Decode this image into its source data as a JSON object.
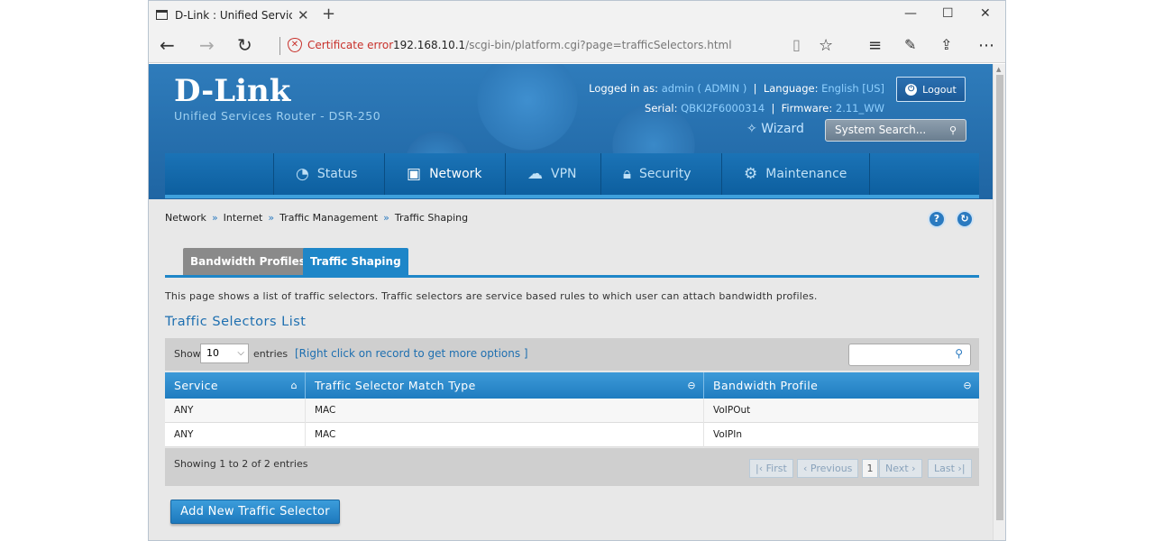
{
  "browser": {
    "tab_title": "D-Link : Unified Service:",
    "tab_close": "✕",
    "new_tab": "+",
    "win_min": "—",
    "win_max": "☐",
    "win_close": "✕",
    "cert_error": "Certificate error",
    "url_host": "192.168.10.1",
    "url_path": "/scgi-bin/platform.cgi?page=trafficSelectors.html"
  },
  "header": {
    "logo": "D-Link",
    "subtitle": "Unified Services Router - DSR-250",
    "logged_in_label": "Logged in as:",
    "user": "admin ( ADMIN )",
    "language_label": "Language:",
    "language": "English [US]",
    "serial_label": "Serial:",
    "serial": "QBKI2F6000314",
    "firmware_label": "Firmware:",
    "firmware": "2.11_WW",
    "logout": "Logout",
    "wizard": "Wizard",
    "search_placeholder": "System Search..."
  },
  "menu": [
    {
      "label": "Status",
      "icon": "gauge-icon"
    },
    {
      "label": "Network",
      "icon": "network-icon"
    },
    {
      "label": "VPN",
      "icon": "cloud-icon"
    },
    {
      "label": "Security",
      "icon": "lock-icon"
    },
    {
      "label": "Maintenance",
      "icon": "gears-icon"
    }
  ],
  "breadcrumb": [
    "Network",
    "Internet",
    "Traffic Management",
    "Traffic Shaping"
  ],
  "tabs": [
    "Bandwidth Profiles",
    "Traffic Shaping"
  ],
  "description": "This page shows a list of traffic selectors. Traffic selectors are service based rules to which user can attach bandwidth profiles.",
  "list_title": "Traffic Selectors List",
  "toolbar": {
    "show_label": "Show",
    "show_value": "10",
    "entries_label": "entries",
    "hint": "[Right click on record to get more options ]"
  },
  "table": {
    "columns": [
      "Service",
      "Traffic Selector Match Type",
      "Bandwidth Profile"
    ],
    "rows": [
      [
        "ANY",
        "MAC",
        "VoIPOut"
      ],
      [
        "ANY",
        "MAC",
        "VoIPIn"
      ]
    ]
  },
  "pager": {
    "info": "Showing 1 to 2 of 2 entries",
    "first": "First",
    "previous": "Previous",
    "page": "1",
    "next": "Next",
    "last": "Last"
  },
  "add_button": "Add New Traffic Selector",
  "colors": {
    "accent": "#1e86c8",
    "header_bg": "#2f7cbb",
    "cert_error": "#c8312b"
  }
}
